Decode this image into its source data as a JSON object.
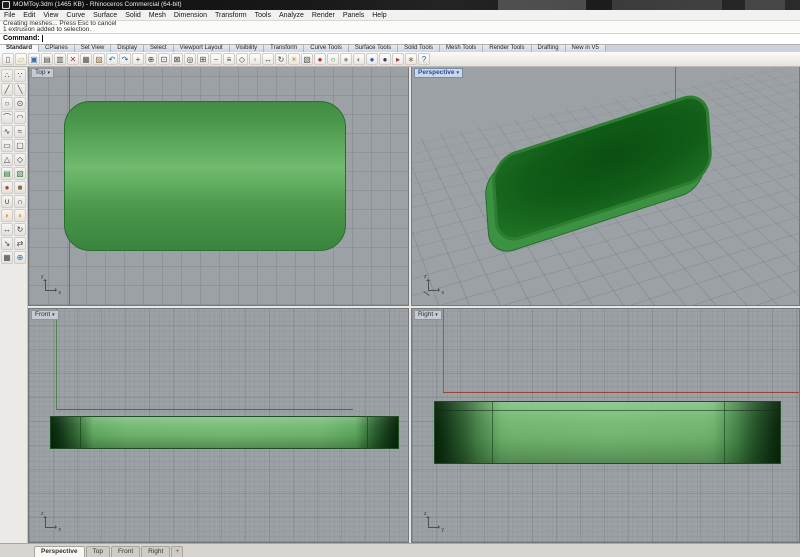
{
  "window": {
    "title": "MOMToy.3dm (1465 KB) - Rhinoceros Commercial (64-bit)"
  },
  "menu": {
    "items": [
      "File",
      "Edit",
      "View",
      "Curve",
      "Surface",
      "Solid",
      "Mesh",
      "Dimension",
      "Transform",
      "Tools",
      "Analyze",
      "Render",
      "Panels",
      "Help"
    ]
  },
  "command": {
    "history_line1": "Creating meshes...  Press Esc to cancel",
    "history_line2": "1 extrusion added to selection.",
    "prompt_label": "Command:"
  },
  "toolbar_tabs": {
    "active": "Standard",
    "items": [
      "Standard",
      "CPlanes",
      "Set View",
      "Display",
      "Select",
      "Viewport Layout",
      "Visibility",
      "Transform",
      "Curve Tools",
      "Surface Tools",
      "Solid Tools",
      "Mesh Tools",
      "Render Tools",
      "Drafting",
      "New in V5"
    ]
  },
  "toolbar": {
    "icons": [
      {
        "n": "new-file",
        "g": "▯",
        "c": "#555555"
      },
      {
        "n": "open-file",
        "g": "▱",
        "c": "#c9a227"
      },
      {
        "n": "save",
        "g": "▣",
        "c": "#3b6ea5"
      },
      {
        "n": "print",
        "g": "▤",
        "c": "#555555"
      },
      {
        "n": "copy-to-clipboard",
        "g": "▥",
        "c": "#555555"
      },
      {
        "n": "cut",
        "g": "✕",
        "c": "#a33b32"
      },
      {
        "n": "copy",
        "g": "▦",
        "c": "#555555"
      },
      {
        "n": "paste",
        "g": "▨",
        "c": "#8a6d3b"
      },
      {
        "n": "undo",
        "g": "↶",
        "c": "#2b5fa5"
      },
      {
        "n": "redo",
        "g": "↷",
        "c": "#2b5fa5"
      },
      {
        "n": "pan",
        "g": "+",
        "c": "#444444"
      },
      {
        "n": "zoom-dynamic",
        "g": "⊕",
        "c": "#444444"
      },
      {
        "n": "zoom-window",
        "g": "⊡",
        "c": "#444444"
      },
      {
        "n": "zoom-extents",
        "g": "⊠",
        "c": "#444444"
      },
      {
        "n": "zoom-selected",
        "g": "◎",
        "c": "#444444"
      },
      {
        "n": "grid-snap",
        "g": "⊞",
        "c": "#444444"
      },
      {
        "n": "ortho",
        "g": "−",
        "c": "#a33b32"
      },
      {
        "n": "planar-mode",
        "g": "≡",
        "c": "#444444"
      },
      {
        "n": "osnap",
        "g": "◇",
        "c": "#444444"
      },
      {
        "n": "record-history",
        "g": "◦",
        "c": "#666666"
      },
      {
        "n": "move",
        "g": "↔",
        "c": "#444444"
      },
      {
        "n": "rotate-view",
        "g": "↻",
        "c": "#444444"
      },
      {
        "n": "light",
        "g": "☀",
        "c": "#d4a017"
      },
      {
        "n": "layers",
        "g": "▧",
        "c": "#555555"
      },
      {
        "n": "render-red-sphere",
        "g": "●",
        "c": "#b03030"
      },
      {
        "n": "render-green-ring",
        "g": "○",
        "c": "#2e8b2e"
      },
      {
        "n": "shaded-sphere-gray",
        "g": "●",
        "c": "#8d9296"
      },
      {
        "n": "shaded-sphere-silver",
        "g": "◐",
        "c": "#7f8487"
      },
      {
        "n": "shaded-sphere-blue",
        "g": "●",
        "c": "#2b5fa5"
      },
      {
        "n": "shaded-sphere-dark",
        "g": "●",
        "c": "#3a3f44"
      },
      {
        "n": "select-brush",
        "g": "▸",
        "c": "#b03030"
      },
      {
        "n": "options",
        "g": "∗",
        "c": "#8a6d3b"
      },
      {
        "n": "help",
        "g": "?",
        "c": "#2b5fa5"
      }
    ]
  },
  "sidebar": {
    "icons": [
      {
        "n": "point",
        "g": "∴",
        "c": "#444444"
      },
      {
        "n": "control-point-curve",
        "g": "∵",
        "c": "#444444"
      },
      {
        "n": "polyline",
        "g": "╱",
        "c": "#444444"
      },
      {
        "n": "line",
        "g": "╲",
        "c": "#444444"
      },
      {
        "n": "circle",
        "g": "○",
        "c": "#444444"
      },
      {
        "n": "circle-3pt",
        "g": "⊙",
        "c": "#444444"
      },
      {
        "n": "arc",
        "g": "⌒",
        "c": "#444444"
      },
      {
        "n": "arc-start-end",
        "g": "◠",
        "c": "#444444"
      },
      {
        "n": "freeform-curve",
        "g": "∿",
        "c": "#444444"
      },
      {
        "n": "interpolate-curve",
        "g": "≈",
        "c": "#444444"
      },
      {
        "n": "rectangle",
        "g": "▭",
        "c": "#444444"
      },
      {
        "n": "rounded-rectangle",
        "g": "▢",
        "c": "#444444"
      },
      {
        "n": "polygon",
        "g": "△",
        "c": "#444444"
      },
      {
        "n": "ellipse",
        "g": "◇",
        "c": "#444444"
      },
      {
        "n": "extrude-surface",
        "g": "▤",
        "c": "#3b7e3b"
      },
      {
        "n": "surface-from-curves",
        "g": "▧",
        "c": "#3b7e3b"
      },
      {
        "n": "sphere",
        "g": "●",
        "c": "#b04030"
      },
      {
        "n": "box",
        "g": "■",
        "c": "#8a6d3b"
      },
      {
        "n": "boolean-union",
        "g": "∪",
        "c": "#444444"
      },
      {
        "n": "boolean-difference",
        "g": "∩",
        "c": "#444444"
      },
      {
        "n": "fillet-edge",
        "g": "◗",
        "c": "#d4a017"
      },
      {
        "n": "chamfer-edge",
        "g": "◖",
        "c": "#d4a017"
      },
      {
        "n": "move",
        "g": "↔",
        "c": "#444444"
      },
      {
        "n": "rotate",
        "g": "↻",
        "c": "#444444"
      },
      {
        "n": "scale",
        "g": "↘",
        "c": "#444444"
      },
      {
        "n": "mirror",
        "g": "⇄",
        "c": "#444444"
      },
      {
        "n": "array",
        "g": "▦",
        "c": "#444444"
      },
      {
        "n": "join",
        "g": "⊕",
        "c": "#2e6da5"
      }
    ]
  },
  "viewports": {
    "top": {
      "label": "Top",
      "axis_v": "y",
      "axis_h": "x"
    },
    "perspective": {
      "label": "Perspective",
      "axis_v": "z",
      "axis_h": "x"
    },
    "front": {
      "label": "Front",
      "axis_v": "z",
      "axis_h": "x"
    },
    "right": {
      "label": "Right",
      "axis_v": "z",
      "axis_h": "y"
    }
  },
  "viewport_tabs": {
    "active": "Perspective",
    "items": [
      "Perspective",
      "Top",
      "Front",
      "Right"
    ],
    "new_tab": "+"
  },
  "icons": {
    "chevron_down": "▾"
  },
  "colors": {
    "viewport_bg": "#9ba1a5",
    "object_green": "#4f9d51",
    "object_dark_green": "#115a17",
    "axis_red": "#9e3428",
    "axis_green": "#2c7a2c",
    "active_viewport_label": "#1f4e9c"
  }
}
